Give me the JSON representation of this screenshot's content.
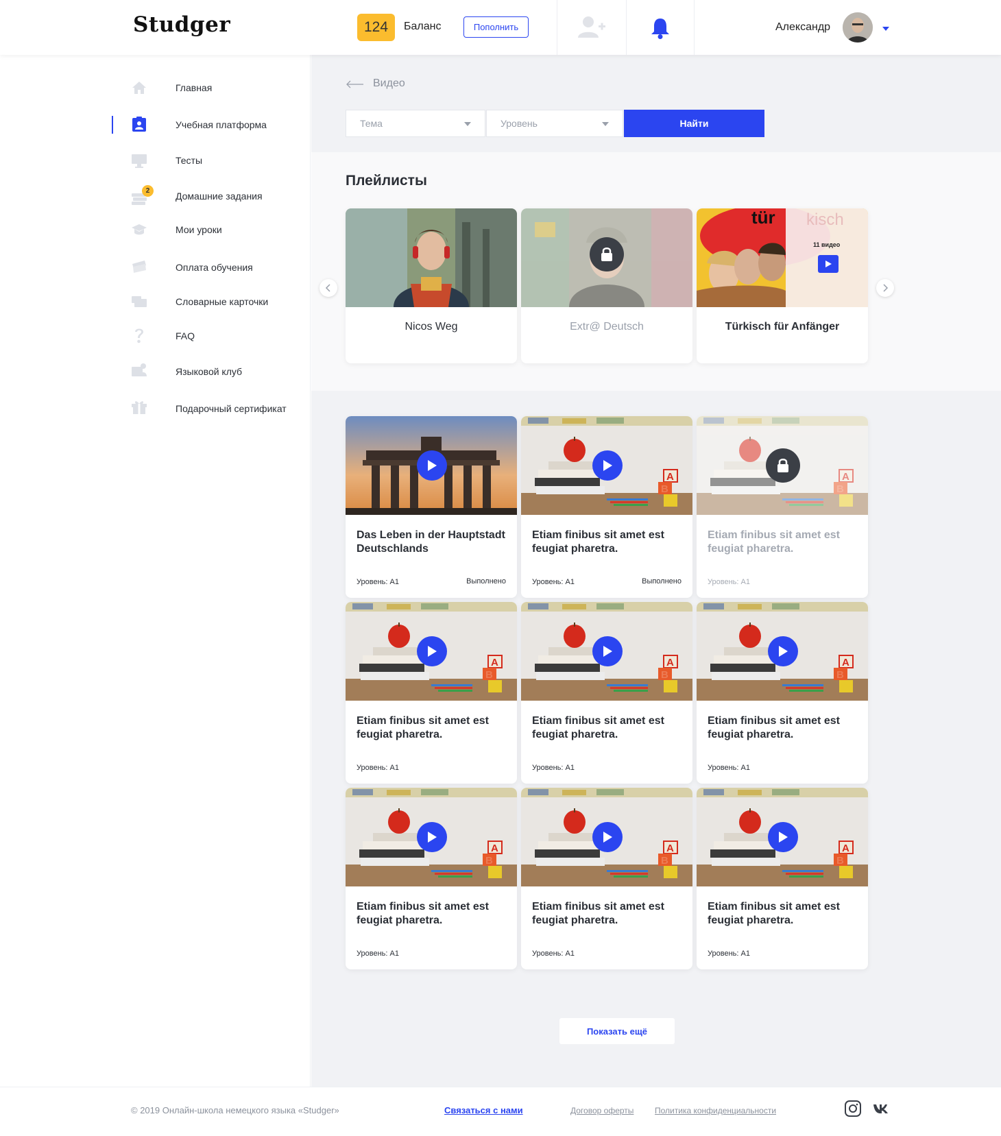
{
  "header": {
    "logo": "Studger",
    "balance_value": "124",
    "balance_label": "Баланс",
    "topup_label": "Пополнить",
    "user_name": "Александр"
  },
  "sidebar": {
    "items": [
      {
        "label": "Главная",
        "icon": "home-icon"
      },
      {
        "label": "Учебная платформа",
        "icon": "clipboard-user-icon",
        "active": true
      },
      {
        "label": "Тесты",
        "icon": "monitor-icon"
      },
      {
        "label": "Домашние задания",
        "icon": "books-stack-icon",
        "badge": "2"
      },
      {
        "label": "Мои уроки",
        "icon": "graduation-cap-icon"
      },
      {
        "label": "Оплата обучения",
        "icon": "wallet-icon"
      },
      {
        "label": "Словарные карточки",
        "icon": "cards-icon"
      },
      {
        "label": "FAQ",
        "icon": "question-icon"
      },
      {
        "label": "Языковой клуб",
        "icon": "club-icon"
      },
      {
        "label": "Подарочный сертификат",
        "icon": "gift-icon"
      }
    ]
  },
  "breadcrumb": {
    "label": "Видео"
  },
  "filters": {
    "topic_placeholder": "Тема",
    "level_placeholder": "Уровень",
    "find_label": "Найти"
  },
  "playlists": {
    "title": "Плейлисты",
    "items": [
      {
        "title": "Nicos Weg",
        "locked": false
      },
      {
        "title": "Extr@ Deutsch",
        "locked": true
      },
      {
        "title": "Türkisch für Anfänger",
        "locked": false,
        "count": "11 видео"
      }
    ]
  },
  "videos": [
    {
      "title": "Das Leben in der Hauptstadt Deutschlands",
      "level": "Уровень: А1",
      "status": "Выполнено"
    },
    {
      "title": "Etiam finibus sit amet est feugiat pharetra.",
      "level": "Уровень: А1",
      "status": "Выполнено"
    },
    {
      "title": "Etiam finibus sit amet est feugiat pharetra.",
      "level": "Уровень: А1",
      "status": ""
    },
    {
      "title": "Etiam finibus sit amet est feugiat pharetra.",
      "level": "Уровень: А1",
      "status": ""
    },
    {
      "title": "Etiam finibus sit amet est feugiat pharetra.",
      "level": "Уровень: А1",
      "status": ""
    },
    {
      "title": "Etiam finibus sit amet est feugiat pharetra.",
      "level": "Уровень: А1",
      "status": ""
    },
    {
      "title": "Etiam finibus sit amet est feugiat pharetra.",
      "level": "Уровень: А1",
      "status": ""
    },
    {
      "title": "Etiam finibus sit amet est feugiat pharetra.",
      "level": "Уровень: А1",
      "status": ""
    },
    {
      "title": "Etiam finibus sit amet est feugiat pharetra.",
      "level": "Уровень: А1",
      "status": ""
    }
  ],
  "more_label": "Показать ещё",
  "footer": {
    "copyright": "© 2019 Онлайн-школа немецкого языка «Studger»",
    "contact": "Связаться с нами",
    "offer": "Договор оферты",
    "privacy": "Политика конфиденциальности"
  },
  "colors": {
    "accent": "#2b45f0",
    "badge": "#fbbc2e"
  }
}
